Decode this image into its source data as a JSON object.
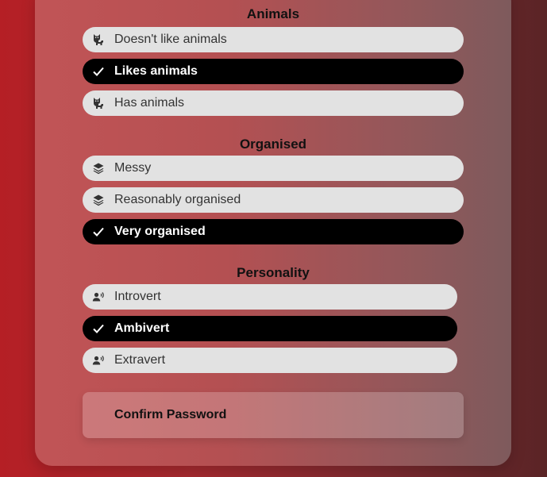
{
  "animals": {
    "title": "Animals",
    "options": [
      {
        "label": "Doesn't like animals",
        "selected": false,
        "icon": "cat-icon"
      },
      {
        "label": "Likes animals",
        "selected": true,
        "icon": "check-icon"
      },
      {
        "label": "Has animals",
        "selected": false,
        "icon": "cat-icon"
      }
    ]
  },
  "organised": {
    "title": "Organised",
    "options": [
      {
        "label": "Messy",
        "selected": false,
        "icon": "layers-icon"
      },
      {
        "label": "Reasonably organised",
        "selected": false,
        "icon": "layers-icon"
      },
      {
        "label": "Very organised",
        "selected": true,
        "icon": "check-icon"
      }
    ]
  },
  "personality": {
    "title": "Personality",
    "options": [
      {
        "label": "Introvert",
        "selected": false,
        "icon": "person-voice-icon"
      },
      {
        "label": "Ambivert",
        "selected": true,
        "icon": "check-icon"
      },
      {
        "label": "Extravert",
        "selected": false,
        "icon": "person-voice-icon"
      }
    ]
  },
  "confirm_password": {
    "label": "Confirm Password"
  },
  "colors": {
    "selected_bg": "#000000",
    "option_bg": "#e2e2e2",
    "page_accent": "#b51f25"
  }
}
